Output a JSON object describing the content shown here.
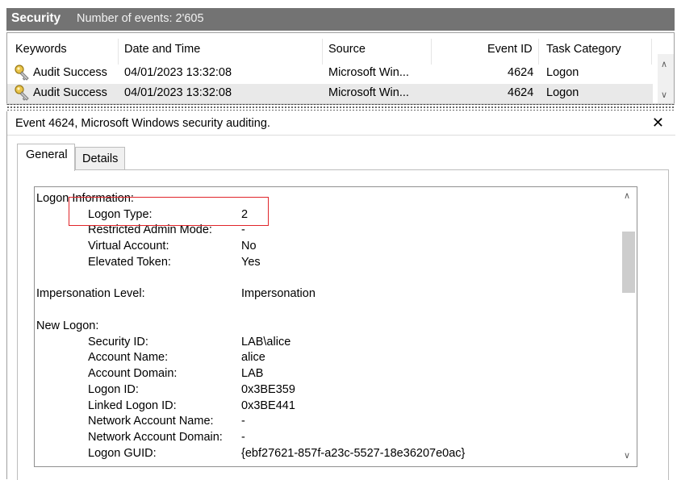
{
  "title": {
    "log_name": "Security",
    "event_count": "Number of events: 2'605"
  },
  "list": {
    "columns": [
      "Keywords",
      "Date and Time",
      "Source",
      "Event ID",
      "Task Category"
    ],
    "rows": [
      {
        "keywords": "Audit Success",
        "date": "04/01/2023 13:32:08",
        "source": "Microsoft Win...",
        "event_id": "4624",
        "category": "Logon"
      },
      {
        "keywords": "Audit Success",
        "date": "04/01/2023 13:32:08",
        "source": "Microsoft Win...",
        "event_id": "4624",
        "category": "Logon"
      }
    ],
    "icon": "key-icon"
  },
  "detail": {
    "title": "Event 4624, Microsoft Windows security auditing.",
    "close_glyph": "✕",
    "tabs": [
      "General",
      "Details"
    ],
    "sections": {
      "logon_info_header": "Logon Information:",
      "logon_type_label": "Logon Type:",
      "logon_type_value": "2",
      "restricted_label": "Restricted Admin Mode:",
      "restricted_value": "-",
      "virtual_label": "Virtual Account:",
      "virtual_value": "No",
      "elevated_label": "Elevated Token:",
      "elevated_value": "Yes",
      "impersonation_label": "Impersonation Level:",
      "impersonation_value": "Impersonation",
      "new_logon_header": "New Logon:",
      "security_id_label": "Security ID:",
      "security_id_value": "LAB\\alice",
      "account_name_label": "Account Name:",
      "account_name_value": "alice",
      "account_domain_label": "Account Domain:",
      "account_domain_value": "LAB",
      "logon_id_label": "Logon ID:",
      "logon_id_value": "0x3BE359",
      "linked_logon_id_label": "Linked Logon ID:",
      "linked_logon_id_value": "0x3BE441",
      "network_account_name_label": "Network Account Name:",
      "network_account_name_value": "-",
      "network_account_domain_label": "Network Account Domain:",
      "network_account_domain_value": "-",
      "logon_guid_label": "Logon GUID:",
      "logon_guid_value": "{ebf27621-857f-a23c-5527-18e36207e0ac}"
    }
  },
  "colors": {
    "titlebar": "#737373",
    "highlight_box": "#e0252a",
    "selected_row": "#e9e9e9"
  }
}
